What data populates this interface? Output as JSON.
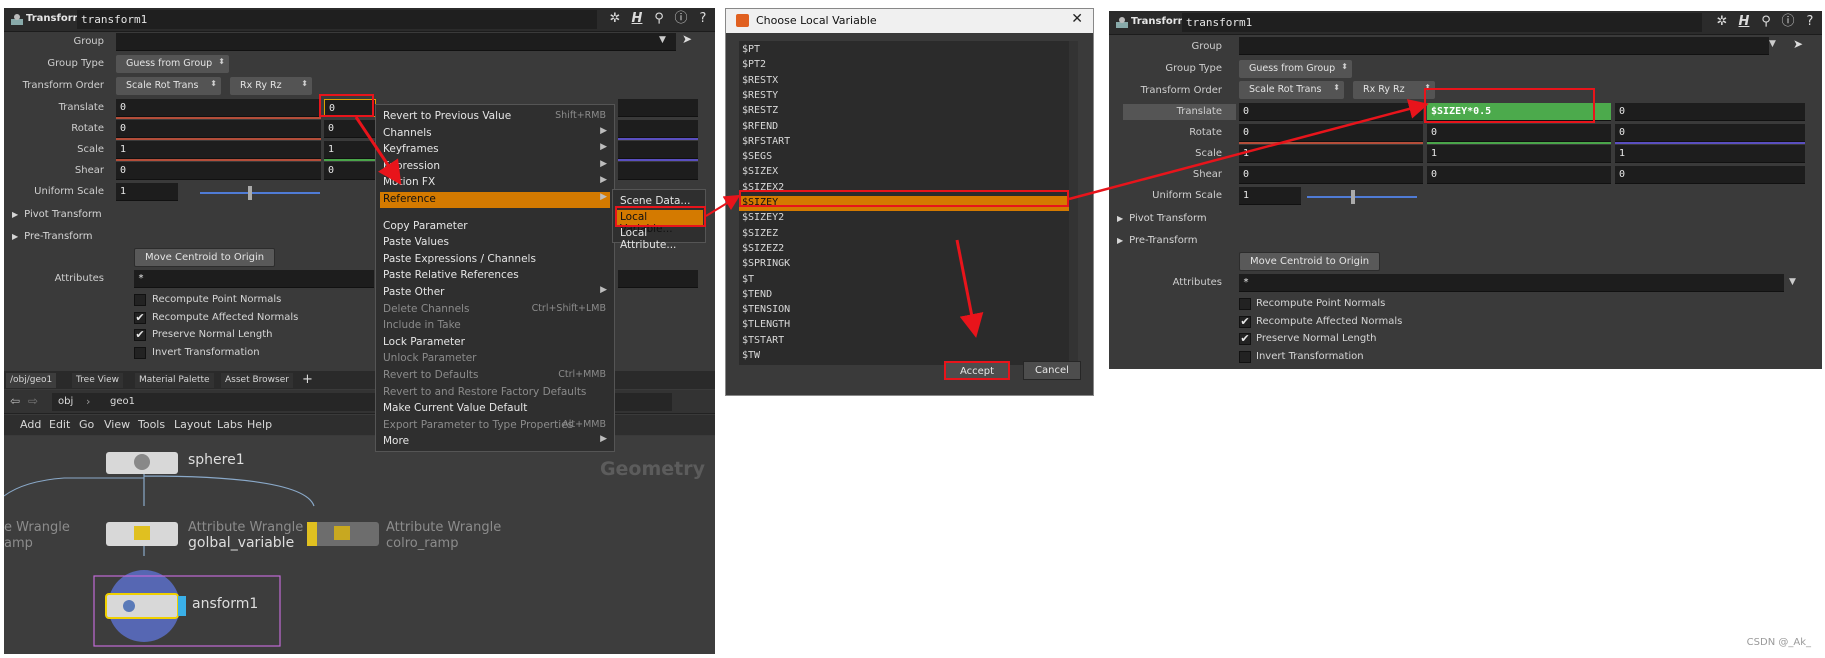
{
  "left_panel": {
    "op_type": "Transform",
    "op_name": "transform1",
    "params": {
      "group_label": "Group",
      "group_value": "",
      "group_type_label": "Group Type",
      "group_type_value": "Guess from Group",
      "transform_order_label": "Transform Order",
      "transform_order_value": "Scale Rot Trans",
      "rotation_order_value": "Rx Ry Rz",
      "translate_label": "Translate",
      "translate": [
        "0",
        "0"
      ],
      "rotate_label": "Rotate",
      "rotate": [
        "0",
        "0"
      ],
      "scale_label": "Scale",
      "scale": [
        "1",
        "1"
      ],
      "shear_label": "Shear",
      "shear": [
        "0",
        "0"
      ],
      "uniform_scale_label": "Uniform Scale",
      "uniform_scale": "1",
      "pivot_transform": "Pivot Transform",
      "pre_transform": "Pre-Transform",
      "move_centroid": "Move Centroid to Origin",
      "attributes_label": "Attributes",
      "attributes_value": "*",
      "checks": [
        {
          "label": "Recompute Point Normals",
          "checked": false
        },
        {
          "label": "Recompute Affected Normals",
          "checked": true
        },
        {
          "label": "Preserve Normal Length",
          "checked": true
        },
        {
          "label": "Invert Transformation",
          "checked": false
        }
      ]
    },
    "tabs": [
      "/obj/geo1",
      "Tree View",
      "Material Palette",
      "Asset Browser"
    ],
    "path": [
      "obj",
      "geo1"
    ],
    "menu": [
      "Add",
      "Edit",
      "Go",
      "View",
      "Tools",
      "Layout",
      "Labs",
      "Help"
    ],
    "network": {
      "context_label": "Geometry",
      "nodes": {
        "sphere": "sphere1",
        "wrangle_left_sub": "e Wrangle",
        "wrangle_left_name": "amp",
        "wrangle_mid_sub": "Attribute Wrangle",
        "wrangle_mid_name": "golbal_variable",
        "wrangle_right_sub": "Attribute Wrangle",
        "wrangle_right_name": "colro_ramp",
        "transform": "ansform1"
      }
    }
  },
  "context_menu": {
    "items": [
      {
        "label": "Revert to Previous Value",
        "shortcut": "Shift+RMB"
      },
      {
        "label": "Channels",
        "sub": true
      },
      {
        "label": "Keyframes",
        "sub": true
      },
      {
        "label": "Expression",
        "sub": true
      },
      {
        "label": "Motion FX",
        "sub": true
      },
      {
        "label": "Reference",
        "sub": true,
        "highlight": true
      },
      {
        "label": "Copy Parameter"
      },
      {
        "label": "Paste Values"
      },
      {
        "label": "Paste Expressions / Channels"
      },
      {
        "label": "Paste Relative References"
      },
      {
        "label": "Paste Other",
        "sub": true
      },
      {
        "label": "Delete Channels",
        "shortcut": "Ctrl+Shift+LMB",
        "disabled": true
      },
      {
        "label": "Include in Take",
        "disabled": true
      },
      {
        "label": "Lock Parameter"
      },
      {
        "label": "Unlock Parameter",
        "disabled": true
      },
      {
        "label": "Revert to Defaults",
        "shortcut": "Ctrl+MMB",
        "disabled": true
      },
      {
        "label": "Revert to and Restore Factory Defaults",
        "disabled": true
      },
      {
        "label": "Make Current Value Default"
      },
      {
        "label": "Export Parameter to Type Properties",
        "shortcut": "Alt+MMB",
        "disabled": true
      },
      {
        "label": "More",
        "sub": true
      }
    ],
    "submenu": [
      "Scene Data...",
      "Local Variable...",
      "Local Attribute..."
    ]
  },
  "dialog": {
    "title": "Choose Local Variable",
    "variables": [
      "$PT",
      "$PT2",
      "$RESTX",
      "$RESTY",
      "$RESTZ",
      "$RFEND",
      "$RFSTART",
      "$SEGS",
      "$SIZEX",
      "$SIZEX2",
      "$SIZEY",
      "$SIZEY2",
      "$SIZEZ",
      "$SIZEZ2",
      "$SPRINGK",
      "$T",
      "$TEND",
      "$TENSION",
      "$TLENGTH",
      "$TSTART",
      "$TW"
    ],
    "selected": "$SIZEY",
    "accept": "Accept",
    "cancel": "Cancel"
  },
  "right_panel": {
    "op_type": "Transform",
    "op_name": "transform1",
    "translate": [
      "0",
      "$SIZEY*0.5",
      "0"
    ],
    "rotate": [
      "0",
      "0",
      "0"
    ],
    "scale": [
      "1",
      "1",
      "1"
    ],
    "shear": [
      "0",
      "0",
      "0"
    ],
    "uniform_scale": "1"
  },
  "watermark": "CSDN @_Ak_",
  "colors": {
    "highlight": "#d47a00",
    "annotation": "#e8141b",
    "expression_field": "#4caa4c"
  }
}
